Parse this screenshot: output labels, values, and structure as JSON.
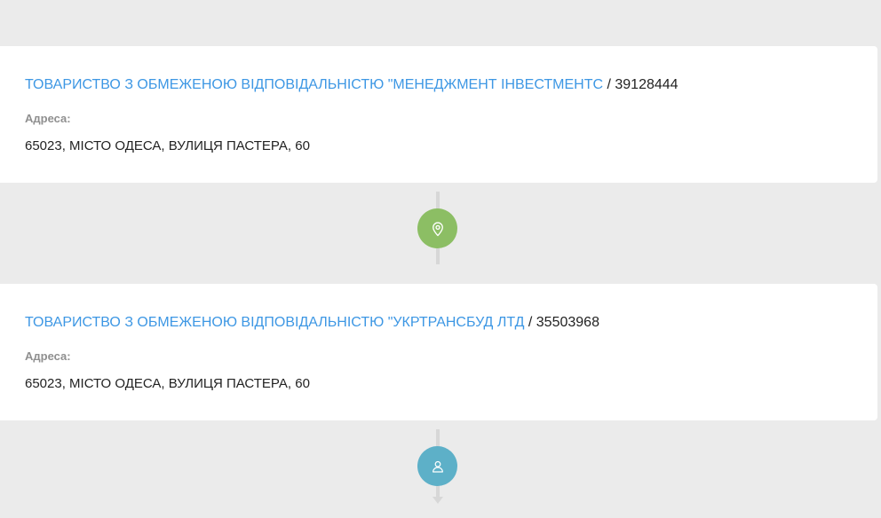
{
  "companies": [
    {
      "name": "ТОВАРИСТВО З ОБМЕЖЕНОЮ ВІДПОВІДАЛЬНІСТЮ \"МЕНЕДЖМЕНТ ІНВЕСТМЕНТС",
      "separator": "/",
      "code": "39128444",
      "address_label": "Адреса:",
      "address": "65023, МІСТО ОДЕСА, ВУЛИЦЯ ПАСТЕРА, 60"
    },
    {
      "name": "ТОВАРИСТВО З ОБМЕЖЕНОЮ ВІДПОВІДАЛЬНІСТЮ \"УКРТРАНСБУД ЛТД",
      "separator": "/",
      "code": "35503968",
      "address_label": "Адреса:",
      "address": "65023, МІСТО ОДЕСА, ВУЛИЦЯ ПАСТЕРА, 60"
    }
  ],
  "connectors": [
    {
      "icon": "location-pin-icon",
      "color": "#8cbe64"
    },
    {
      "icon": "person-icon",
      "color": "#5db0c8"
    }
  ],
  "colors": {
    "background": "#ebebeb",
    "card": "#ffffff",
    "link": "#3d97e4",
    "text": "#222222",
    "label": "#8f8f8f",
    "connector_line": "#d7d7d7"
  }
}
